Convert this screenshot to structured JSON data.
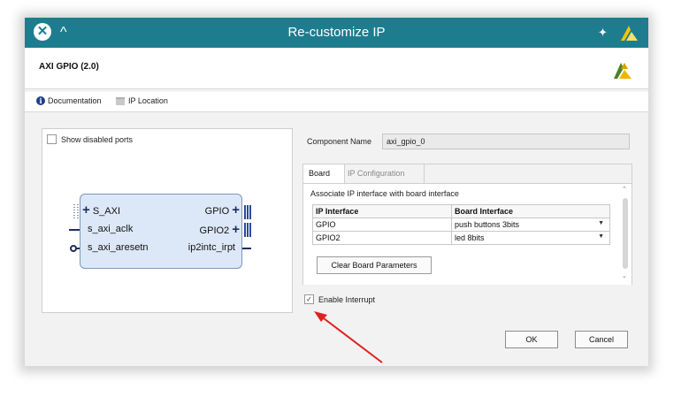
{
  "window": {
    "title": "Re-customize IP",
    "ip_title": "AXI GPIO (2.0)"
  },
  "links": {
    "documentation": "Documentation",
    "ip_location": "IP Location"
  },
  "left_panel": {
    "show_disabled_ports": "Show disabled ports",
    "ports_left": [
      "S_AXI",
      "s_axi_aclk",
      "s_axi_aresetn"
    ],
    "ports_right": [
      "GPIO",
      "GPIO2",
      "ip2intc_irpt"
    ]
  },
  "component": {
    "label": "Component Name",
    "value": "axi_gpio_0"
  },
  "tabs": [
    "Board",
    "IP Configuration"
  ],
  "board": {
    "caption": "Associate IP interface with board interface",
    "headers": [
      "IP Interface",
      "Board Interface"
    ],
    "rows": [
      {
        "ip": "GPIO",
        "board": "push buttons 3bits"
      },
      {
        "ip": "GPIO2",
        "board": "led 8bits"
      }
    ],
    "clear_button": "Clear Board Parameters"
  },
  "enable_interrupt": {
    "label": "Enable Interrupt",
    "checked": true
  },
  "buttons": {
    "ok": "OK",
    "cancel": "Cancel"
  },
  "colors": {
    "titlebar": "#1d7d8e",
    "annotation_arrow": "#e02020",
    "ip_block_fill": "#dce8f7"
  }
}
